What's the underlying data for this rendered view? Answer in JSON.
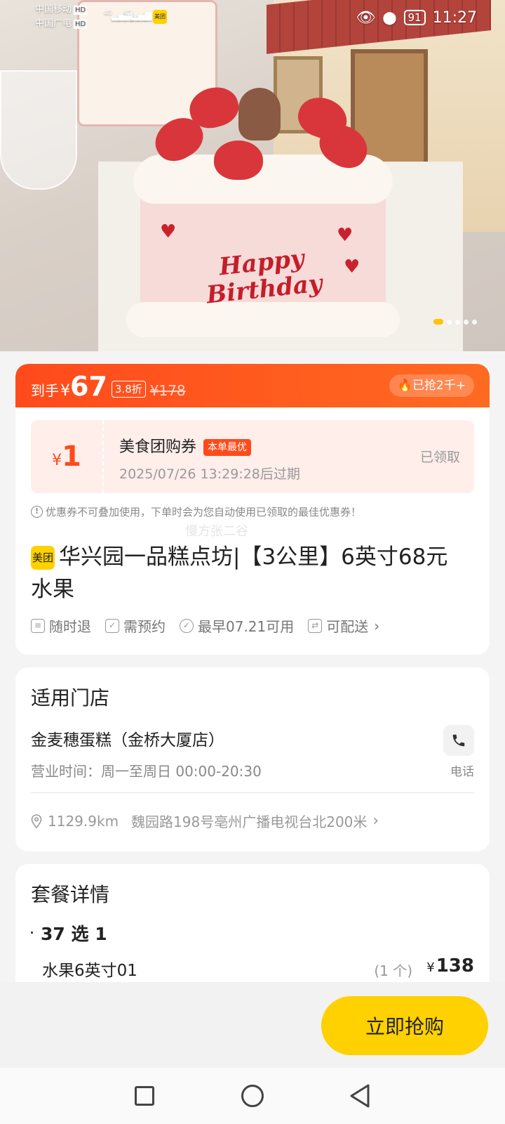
{
  "status_bar": {
    "carrier1": "中国移动",
    "carrier2": "中国广电",
    "hd": "HD",
    "signal1": "4G",
    "signal2": "4G",
    "app_badge": "美团",
    "battery": "91",
    "time": "11:27"
  },
  "hero": {
    "cake_text": "Happy Birthday",
    "page_count": 5,
    "active_page": 1
  },
  "price_band": {
    "label": "到手",
    "currency": "¥",
    "price": "67",
    "discount": "3.8折",
    "original": "¥178",
    "sold": "已抢2千+"
  },
  "coupon": {
    "currency": "¥",
    "amount": "1",
    "title": "美食团购券",
    "tag": "本单最优",
    "expiry": "2025/07/26 13:29:28后过期",
    "status": "已领取"
  },
  "notice": "优惠券不可叠加使用，下单时会为您自动使用已领取的最佳优惠券！",
  "watermark": "慢方张二谷",
  "product": {
    "brand_logo": "美团",
    "title": "华兴园一品糕点坊|【3公里】6英寸68元水果"
  },
  "features": [
    {
      "icon": "receipt-icon",
      "label": "随时退"
    },
    {
      "icon": "calendar-check-icon",
      "label": "需预约"
    },
    {
      "icon": "check-circle-icon",
      "label": "最早07.21可用"
    },
    {
      "icon": "delivery-icon",
      "label": "可配送"
    }
  ],
  "store": {
    "section_title": "适用门店",
    "name": "金麦穗蛋糕（金桥大厦店）",
    "hours": "营业时间：周一至周日 00:00-20:30",
    "phone_label": "电话",
    "distance": "1129.9km",
    "address": "魏园路198号亳州广播电视台北200米"
  },
  "package": {
    "section_title": "套餐详情",
    "subtitle": "37 选 1",
    "item_name": "水果6英寸01",
    "item_qty": "(1 个)",
    "item_currency": "¥",
    "item_price": "138"
  },
  "action": {
    "buy_label": "立即抢购"
  },
  "colors": {
    "accent_orange": "#ff4a1c",
    "brand_yellow": "#ffd100"
  }
}
